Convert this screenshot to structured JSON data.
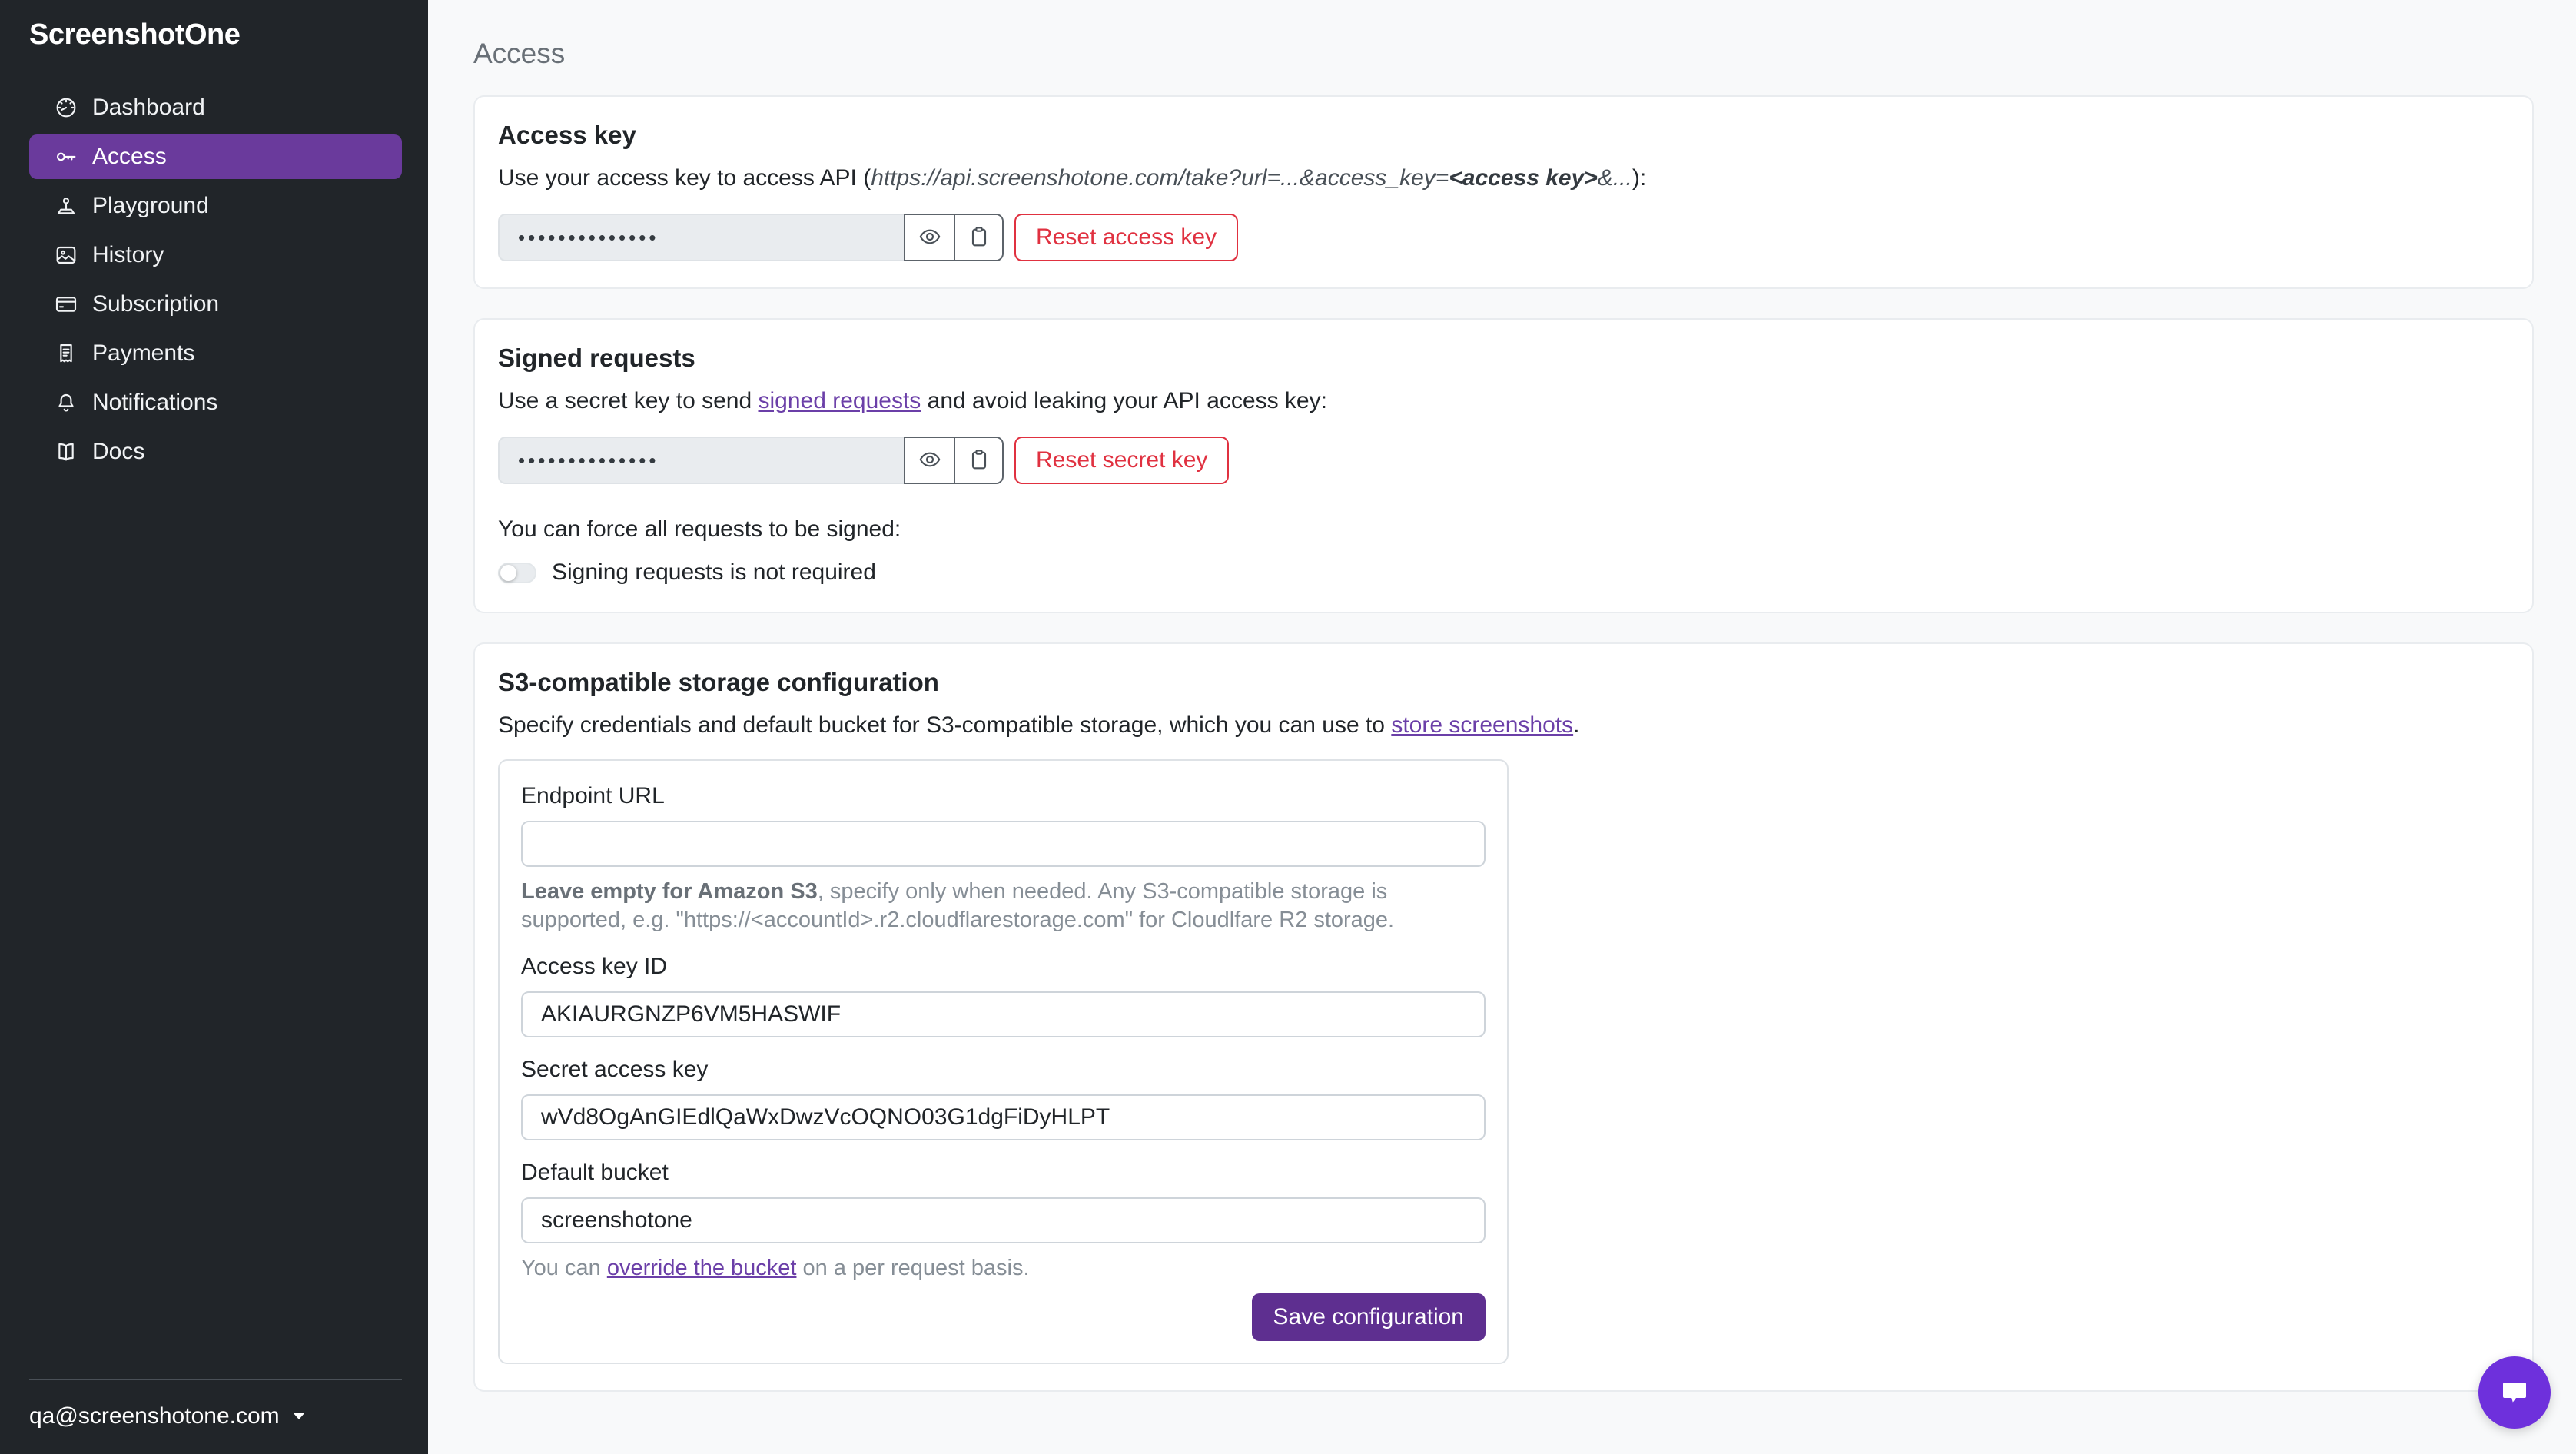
{
  "sidebar": {
    "logo": "ScreenshotOne",
    "items": [
      {
        "label": "Dashboard",
        "icon": "speedometer-icon",
        "active": false
      },
      {
        "label": "Access",
        "icon": "key-icon",
        "active": true
      },
      {
        "label": "Playground",
        "icon": "joystick-icon",
        "active": false
      },
      {
        "label": "History",
        "icon": "photo-icon",
        "active": false
      },
      {
        "label": "Subscription",
        "icon": "credit-card-icon",
        "active": false
      },
      {
        "label": "Payments",
        "icon": "receipt-icon",
        "active": false
      },
      {
        "label": "Notifications",
        "icon": "bell-icon",
        "active": false
      },
      {
        "label": "Docs",
        "icon": "book-icon",
        "active": false
      }
    ],
    "user_email": "qa@screenshotone.com"
  },
  "page": {
    "title": "Access"
  },
  "access_key_card": {
    "title": "Access key",
    "description_prefix": "Use your access key to access API (",
    "description_url": "https://api.screenshotone.com/take?url=...&access_key=",
    "description_url_bold": "<access key>",
    "description_url_suffix": "&...",
    "description_suffix": "):",
    "masked_value": "••••••••••••••",
    "reset_button": "Reset access key"
  },
  "signed_requests_card": {
    "title": "Signed requests",
    "description_prefix": "Use a secret key to send ",
    "description_link": "signed requests",
    "description_suffix": " and avoid leaking your API access key:",
    "masked_value": "••••••••••••••",
    "reset_button": "Reset secret key",
    "force_text": "You can force all requests to be signed:",
    "toggle_label": "Signing requests is not required",
    "toggle_state": "off"
  },
  "s3_card": {
    "title": "S3-compatible storage configuration",
    "description_prefix": "Specify credentials and default bucket for S3-compatible storage, which you can use to ",
    "description_link": "store screenshots",
    "description_suffix": ".",
    "endpoint": {
      "label": "Endpoint URL",
      "value": "",
      "help_bold": "Leave empty for Amazon S3",
      "help_rest": ", specify only when needed. Any S3-compatible storage is supported, e.g. \"https://<accountId>.r2.cloudflarestorage.com\" for Cloudlfare R2 storage."
    },
    "access_key_id": {
      "label": "Access key ID",
      "value": "AKIAURGNZP6VM5HASWIF"
    },
    "secret_access_key": {
      "label": "Secret access key",
      "value": "wVd8OgAnGIEdlQaWxDwzVcOQNO03G1dgFiDyHLPT"
    },
    "default_bucket": {
      "label": "Default bucket",
      "value": "screenshotone"
    },
    "override_prefix": "You can ",
    "override_link": "override the bucket",
    "override_suffix": " on a per request basis.",
    "save_button": "Save configuration"
  },
  "colors": {
    "sidebar_bg": "#212529",
    "sidebar_active": "#6a3a9c",
    "link": "#6b3fa8",
    "danger": "#e03140",
    "save_button": "#5e2f90",
    "chat_button": "#6e30dc",
    "page_bg": "#f8f9fa"
  }
}
